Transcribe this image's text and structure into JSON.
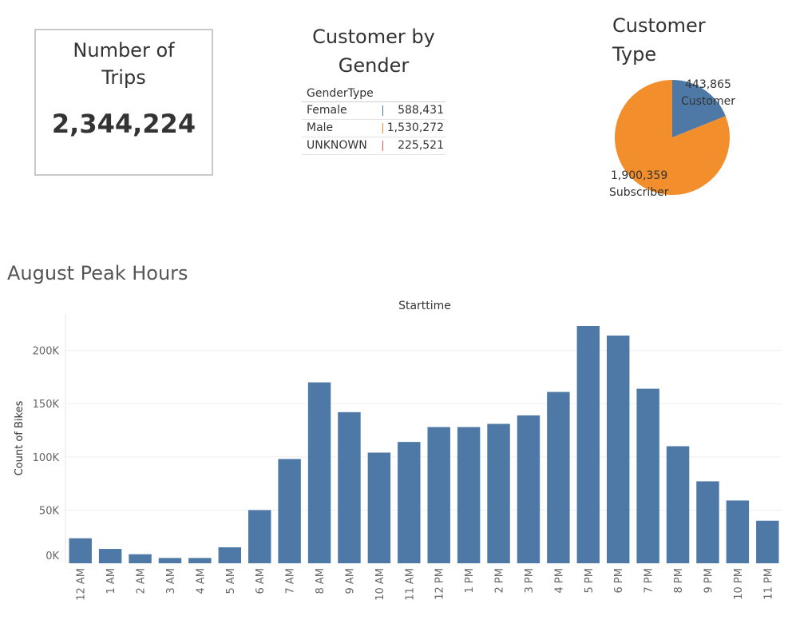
{
  "kpi": {
    "title": "Number of Trips",
    "value": "2,344,224"
  },
  "gender": {
    "title": "Customer by Gender",
    "column_header": "GenderType",
    "rows": [
      {
        "label": "Female",
        "value": "588,431",
        "color": "#4e79a7"
      },
      {
        "label": "Male",
        "value": "1,530,272",
        "color": "#f28e2b"
      },
      {
        "label": "UNKNOWN",
        "value": "225,521",
        "color": "#e15759"
      }
    ]
  },
  "customer_type": {
    "title": "Customer Type",
    "slices": [
      {
        "value_label": "443,865",
        "label": "Customer",
        "value": 443865,
        "color": "#4e79a7"
      },
      {
        "value_label": "1,900,359",
        "label": "Subscriber",
        "value": 1900359,
        "color": "#f28e2b"
      }
    ]
  },
  "peak_hours": {
    "title": "August Peak Hours"
  },
  "chart_data": [
    {
      "type": "pie",
      "title": "Customer Type",
      "categories": [
        "Customer",
        "Subscriber"
      ],
      "values": [
        443865,
        1900359
      ]
    },
    {
      "type": "bar",
      "title": "August Peak Hours",
      "xlabel": "Starttime",
      "ylabel": "Count of Bikes",
      "categories": [
        "12 AM",
        "1 AM",
        "2 AM",
        "3 AM",
        "4 AM",
        "5 AM",
        "6 AM",
        "7 AM",
        "8 AM",
        "9 AM",
        "10 AM",
        "11 AM",
        "12 PM",
        "1 PM",
        "2 PM",
        "3 PM",
        "4 PM",
        "5 PM",
        "6 PM",
        "7 PM",
        "8 PM",
        "9 PM",
        "10 PM",
        "11 PM"
      ],
      "values": [
        23500,
        13500,
        8500,
        5000,
        5000,
        15000,
        50000,
        98000,
        170000,
        142000,
        104000,
        114000,
        128000,
        128000,
        131000,
        139000,
        161000,
        223000,
        214000,
        164000,
        110000,
        77000,
        59000,
        40000
      ],
      "yticks": [
        "0K",
        "50K",
        "100K",
        "150K",
        "200K"
      ],
      "ylim": [
        0,
        235000
      ],
      "grid": true,
      "bar_color": "#4e79a7"
    }
  ]
}
